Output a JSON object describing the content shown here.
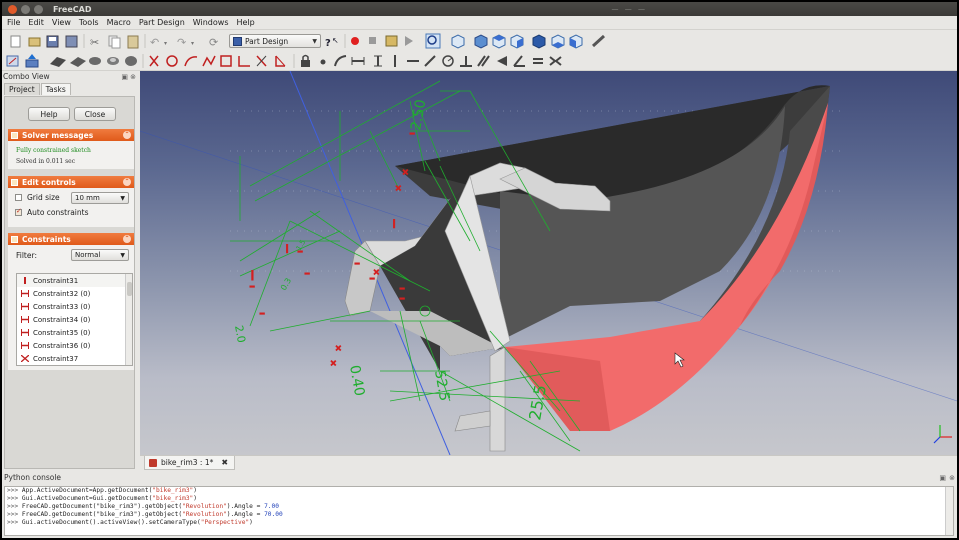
{
  "window": {
    "title": "FreeCAD",
    "tray_glyphs": "— — —"
  },
  "menu": [
    "File",
    "Edit",
    "View",
    "Tools",
    "Macro",
    "Part Design",
    "Windows",
    "Help"
  ],
  "toolbar": {
    "workbench": "Part Design"
  },
  "combo_view": {
    "title": "Combo View",
    "tabs": [
      "Project",
      "Tasks"
    ],
    "active_tab": "Tasks",
    "help_label": "Help",
    "close_label": "Close",
    "solver": {
      "title": "Solver messages",
      "status": "Fully constrained sketch",
      "time": "Solved in 0.011 sec"
    },
    "edit_controls": {
      "title": "Edit controls",
      "grid_size_label": "Grid size",
      "grid_size_checked": false,
      "grid_size_value": "10 mm",
      "auto_constraints_label": "Auto constraints",
      "auto_constraints_checked": true
    },
    "constraints": {
      "title": "Constraints",
      "filter_label": "Filter:",
      "filter_value": "Normal",
      "items": [
        {
          "label": "Constraint31",
          "icon": "vertical-constraint-icon"
        },
        {
          "label": "Constraint32 (0)",
          "icon": "horizontal-distance-icon"
        },
        {
          "label": "Constraint33 (0)",
          "icon": "horizontal-distance-icon"
        },
        {
          "label": "Constraint34 (0)",
          "icon": "horizontal-distance-icon"
        },
        {
          "label": "Constraint35 (0)",
          "icon": "horizontal-distance-icon"
        },
        {
          "label": "Constraint36 (0)",
          "icon": "horizontal-distance-icon"
        },
        {
          "label": "Constraint37",
          "icon": "symmetric-constraint-icon"
        }
      ]
    }
  },
  "document_tab": {
    "label": "bike_rim3 : 1*"
  },
  "console": {
    "title": "Python console",
    "lines": [
      [
        ">>> ",
        "App.ActiveDocument=App.getDocument(",
        "\"bike_rim3\"",
        ")",
        ""
      ],
      [
        ">>> ",
        "Gui.ActiveDocument=Gui.getDocument(",
        "\"bike_rim3\"",
        ")",
        ""
      ],
      [
        ">>> ",
        "FreeCAD.getDocument(\"bike_rim3\").getObject(",
        "\"Revolution\"",
        ").Angle = ",
        "7.00"
      ],
      [
        ">>> ",
        "FreeCAD.getDocument(\"bike_rim3\").getObject(",
        "\"Revolution\"",
        ").Angle = ",
        "70.00"
      ],
      [
        ">>> ",
        "Gui.activeDocument().activeView().setCameraType(",
        "\"Perspective\"",
        ")",
        ""
      ]
    ]
  },
  "colors": {
    "panel_header": "#e05a1a",
    "solid_dark": "#4a4a4a",
    "solid_face_pink": "#f26b6b",
    "sketch_green": "#1fae2e",
    "constraint_red": "#d42020"
  }
}
